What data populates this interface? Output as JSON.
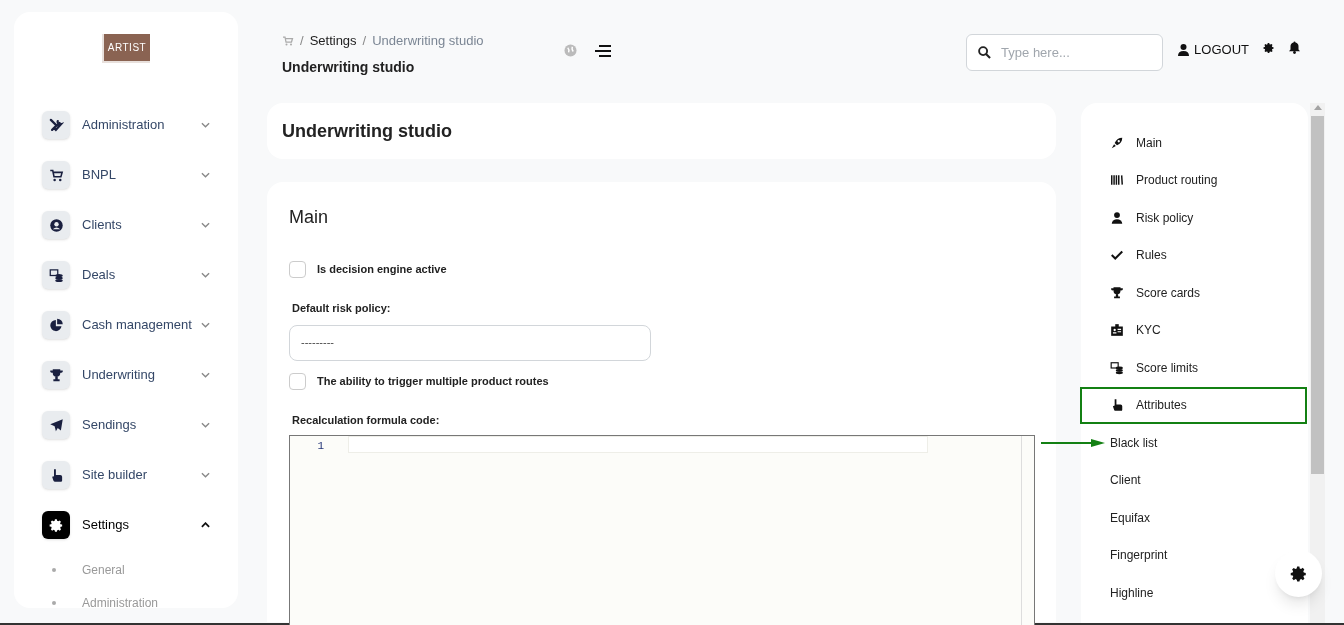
{
  "logo": {
    "text": "ARTIST"
  },
  "sidebar": {
    "items": [
      {
        "label": "Administration",
        "selected": false,
        "expanded": false
      },
      {
        "label": "BNPL",
        "selected": false,
        "expanded": false
      },
      {
        "label": "Clients",
        "selected": false,
        "expanded": false
      },
      {
        "label": "Deals",
        "selected": false,
        "expanded": false
      },
      {
        "label": "Cash management",
        "selected": false,
        "expanded": false
      },
      {
        "label": "Underwriting",
        "selected": false,
        "expanded": false
      },
      {
        "label": "Sendings",
        "selected": false,
        "expanded": false
      },
      {
        "label": "Site builder",
        "selected": false,
        "expanded": false
      },
      {
        "label": "Settings",
        "selected": true,
        "expanded": true,
        "children": [
          {
            "label": "General"
          },
          {
            "label": "Administration"
          }
        ]
      }
    ]
  },
  "breadcrumb": {
    "separator": "/",
    "items": [
      "Settings",
      "Underwriting studio"
    ]
  },
  "page_title": "Underwriting studio",
  "search": {
    "placeholder": "Type here..."
  },
  "logout": "LOGOUT",
  "studio_title": "Underwriting studio",
  "form": {
    "title": "Main",
    "fields": [
      {
        "kind": "checkbox",
        "label": "Is decision engine active",
        "checked": false
      },
      {
        "kind": "select",
        "label": "Default risk policy:",
        "value": "---------"
      },
      {
        "kind": "checkbox",
        "label": "The ability to trigger multiple product routes",
        "checked": false
      },
      {
        "kind": "code",
        "label": "Recalculation formula code:",
        "line_numbers": [
          "1"
        ]
      }
    ]
  },
  "section_nav": [
    {
      "label": "Main",
      "outlined": false,
      "arrow": false
    },
    {
      "label": "Product routing",
      "outlined": false,
      "arrow": false
    },
    {
      "label": "Risk policy",
      "outlined": false,
      "arrow": false
    },
    {
      "label": "Rules",
      "outlined": false,
      "arrow": false
    },
    {
      "label": "Score cards",
      "outlined": false,
      "arrow": false
    },
    {
      "label": "KYC",
      "outlined": false,
      "arrow": false
    },
    {
      "label": "Score limits",
      "outlined": false,
      "arrow": false
    },
    {
      "label": "Attributes",
      "outlined": true,
      "arrow": false
    },
    {
      "label": "Black list",
      "outlined": false,
      "arrow": true
    },
    {
      "label": "Client",
      "outlined": false,
      "arrow": false
    },
    {
      "label": "Equifax",
      "outlined": false,
      "arrow": false
    },
    {
      "label": "Fingerprint",
      "outlined": false,
      "arrow": false
    },
    {
      "label": "Highline",
      "outlined": false,
      "arrow": false
    }
  ]
}
